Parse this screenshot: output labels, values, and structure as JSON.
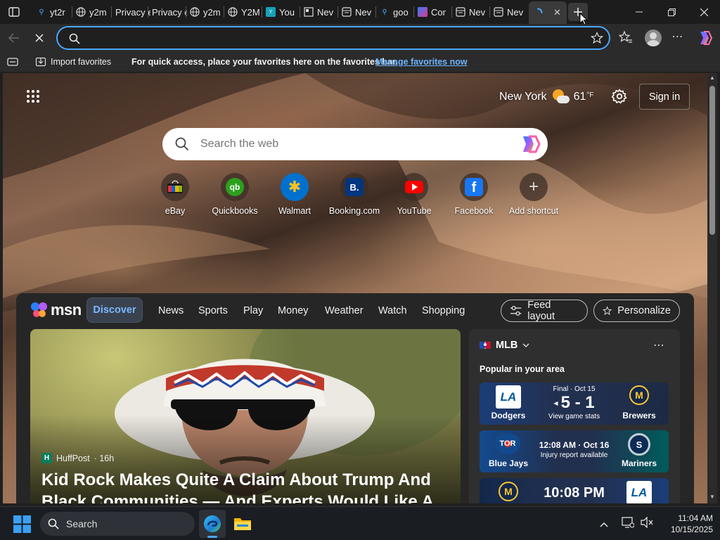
{
  "tabs": [
    {
      "label": "yt2r",
      "icon": "search-icon"
    },
    {
      "label": "y2m",
      "icon": "globe-icon"
    },
    {
      "label": "Privacy e",
      "icon": "page-icon"
    },
    {
      "label": "Privacy e",
      "icon": "page-icon"
    },
    {
      "label": "y2m",
      "icon": "globe-icon"
    },
    {
      "label": "Y2M",
      "icon": "globe-icon"
    },
    {
      "label": "You",
      "icon": "y2mate-icon"
    },
    {
      "label": "Nev",
      "icon": "window-icon"
    },
    {
      "label": "Nev",
      "icon": "newtab-icon"
    },
    {
      "label": "goo",
      "icon": "search-icon"
    },
    {
      "label": "Cor",
      "icon": "copilot-icon"
    },
    {
      "label": "Nev",
      "icon": "newtab-icon"
    },
    {
      "label": "Nev",
      "icon": "newtab-icon"
    }
  ],
  "active_tab": {
    "state": "loading"
  },
  "address_bar": {
    "value": "",
    "placeholder": ""
  },
  "favorites_bar": {
    "import_label": "Import favorites",
    "message": "For quick access, place your favorites here on the favorites bar.",
    "manage_link": "Manage favorites now"
  },
  "header": {
    "city": "New York",
    "temperature": "61",
    "unit": "°F",
    "sign_in": "Sign in"
  },
  "search": {
    "placeholder": "Search the web"
  },
  "shortcuts": [
    {
      "label": "eBay"
    },
    {
      "label": "Quickbooks"
    },
    {
      "label": "Walmart"
    },
    {
      "label": "Booking.com"
    },
    {
      "label": "YouTube"
    },
    {
      "label": "Facebook"
    },
    {
      "label": "Add shortcut"
    }
  ],
  "shortcut_glyphs": {
    "walmart": "✱",
    "booking": "B.",
    "facebook": "f",
    "add": "+"
  },
  "msn": {
    "brand": "msn",
    "nav": [
      "Discover",
      "News",
      "Sports",
      "Play",
      "Money",
      "Weather",
      "Watch",
      "Shopping"
    ],
    "feed_layout": "Feed layout",
    "personalize": "Personalize"
  },
  "hero": {
    "source": "HuffPost",
    "age": "· 16h",
    "source_badge": "H",
    "headline": "Kid Rock Makes Quite A Claim About Trump And Black Communities — And Experts Would Like A"
  },
  "mlb": {
    "title": "MLB",
    "subtitle": "Popular in your area",
    "games": [
      {
        "status": "Final · Oct 15",
        "score": "5 - 1",
        "detail": "View game stats",
        "home": "Dodgers",
        "away": "Brewers",
        "home_logo": "LA",
        "away_logo": "M"
      },
      {
        "status": "12:08 AM · Oct 16",
        "score": "",
        "detail": "Injury report available",
        "home": "Blue Jays",
        "away": "Mariners",
        "home_logo": "TOR",
        "away_logo": "S"
      },
      {
        "status": "",
        "score": "10:08 PM",
        "detail": "",
        "home": "",
        "away": "",
        "home_logo": "M",
        "away_logo": "LA"
      }
    ]
  },
  "taskbar": {
    "search_label": "Search",
    "time": "11:04 AM",
    "date": "10/15/2025"
  },
  "colors": {
    "accent": "#4aa8ff",
    "link": "#6cb4ff",
    "discover_pill": "#3a4250"
  }
}
